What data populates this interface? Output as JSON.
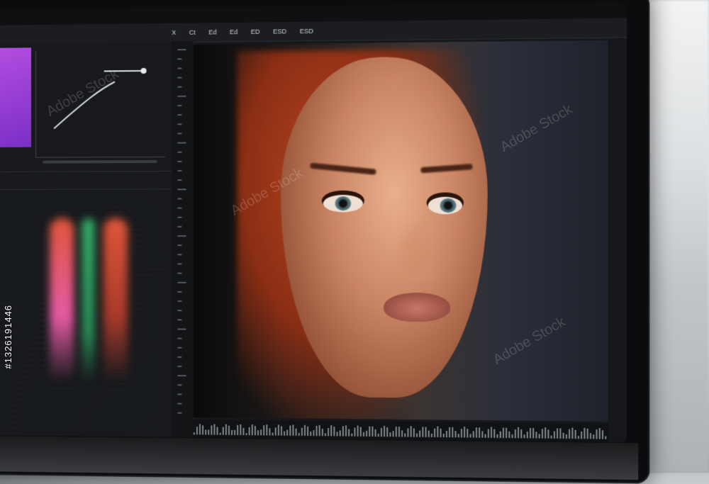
{
  "scene": {
    "description_tags": [
      "laptop-screen",
      "photo-editing-app",
      "portrait"
    ]
  },
  "menubar": {
    "items": [
      "",
      "",
      "",
      ""
    ]
  },
  "toolbar": {
    "items": [
      "X",
      "Ct",
      "Ed",
      "Ed",
      "ED",
      "ESD",
      "ESD"
    ]
  },
  "left_panel": {
    "histogram_header": [
      "",
      "",
      ""
    ],
    "curve_values": [
      "",
      "",
      "",
      "",
      "",
      "",
      "",
      ""
    ]
  },
  "watermark": {
    "text": "Adobe Stock",
    "id": "#1326191446"
  },
  "colors": {
    "accent_purple": "#b34de0",
    "histogram_red": "#e0563a",
    "histogram_green": "#35b06a",
    "histogram_magenta": "#e45aa3",
    "hair": "#b8451f"
  }
}
